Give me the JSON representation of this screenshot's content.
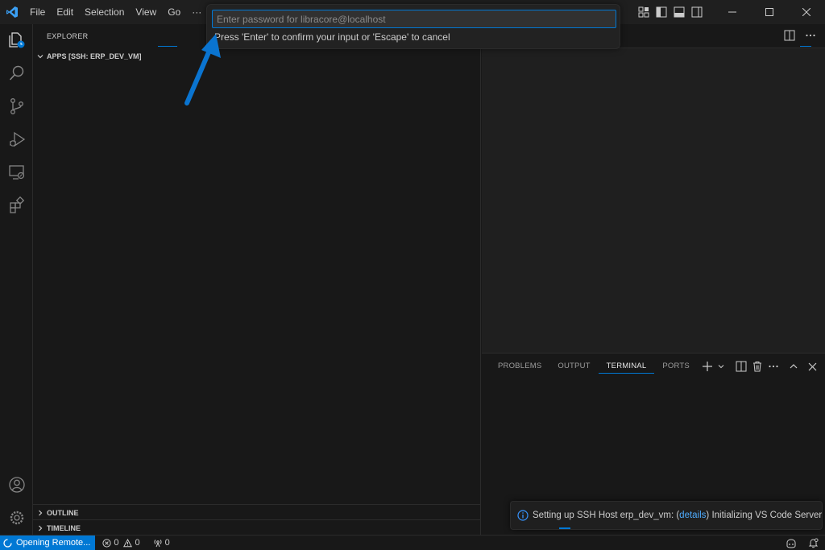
{
  "titlebar": {
    "menu": [
      "File",
      "Edit",
      "Selection",
      "View",
      "Go",
      "···"
    ],
    "icons": [
      "customize-layout-icon",
      "toggle-primary-sidebar-icon",
      "toggle-panel-icon",
      "toggle-secondary-sidebar-icon"
    ],
    "window_buttons": [
      "minimize-icon",
      "maximize-icon",
      "close-icon"
    ]
  },
  "activity_bar": [
    "explorer-icon",
    "search-icon",
    "source-control-icon",
    "run-debug-icon",
    "remote-explorer-icon",
    "extensions-icon",
    "accounts-icon",
    "manage-gear-icon"
  ],
  "sidebar": {
    "title": "EXPLORER",
    "folder": "APPS [SSH: ERP_DEV_VM]",
    "outline": "OUTLINE",
    "timeline": "TIMELINE"
  },
  "quick_input": {
    "placeholder": "Enter password for libracore@localhost",
    "message": "Press 'Enter' to confirm your input or 'Escape' to cancel"
  },
  "panel": {
    "tabs": [
      "PROBLEMS",
      "OUTPUT",
      "TERMINAL",
      "PORTS"
    ],
    "active_tab": "TERMINAL"
  },
  "notification": {
    "text_before": "Setting up SSH Host erp_dev_vm: (",
    "link": "details",
    "text_after": ") Initializing VS Code Server"
  },
  "statusbar": {
    "remote": "Opening Remote...",
    "errors": "0",
    "warnings": "0",
    "ports": "0"
  },
  "colors": {
    "accent": "#0078d4",
    "annotation_arrow": "#0a74d0",
    "link": "#4daafc"
  }
}
